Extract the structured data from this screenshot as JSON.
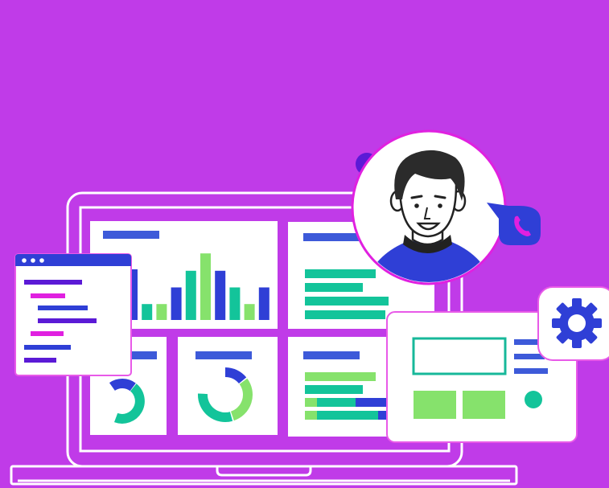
{
  "illustration": {
    "background": "#c03be8",
    "colors": {
      "outline": "#ffffff",
      "panel": "#ffffff",
      "blue": "#3d5ad9",
      "royal": "#2f3fd6",
      "purple": "#5b1ad6",
      "teal": "#13c49a",
      "green": "#86e26c",
      "magenta": "#e020e0",
      "teal_frame": "#17b89a"
    },
    "bar_chart": {
      "series": [
        {
          "name": "",
          "values": [
            70,
            22,
            22,
            45,
            68,
            92,
            68,
            45,
            22,
            45
          ]
        }
      ],
      "bar_colors": [
        "royal",
        "teal",
        "green",
        "royal",
        "teal",
        "green",
        "royal",
        "teal",
        "green",
        "royal"
      ]
    },
    "horizontal_bars": {
      "values": [
        88,
        72,
        104,
        100
      ]
    },
    "donut_left": {
      "segments": [
        {
          "value": 20,
          "color": "royal"
        },
        {
          "value": 45,
          "color": "teal"
        }
      ]
    },
    "donut_right": {
      "segments": [
        {
          "value": 14,
          "color": "royal"
        },
        {
          "value": 30,
          "color": "green"
        },
        {
          "value": 30,
          "color": "teal"
        }
      ]
    },
    "stacked_bars": {
      "rows": [
        [
          {
            "v": 88,
            "c": "green"
          }
        ],
        [
          {
            "v": 72,
            "c": "teal"
          }
        ],
        [
          {
            "v": 15,
            "c": "green"
          },
          {
            "v": 48,
            "c": "teal"
          },
          {
            "v": 40,
            "c": "royal"
          }
        ],
        [
          {
            "v": 15,
            "c": "green"
          },
          {
            "v": 76,
            "c": "teal"
          },
          {
            "v": 20,
            "c": "royal"
          }
        ]
      ]
    },
    "icons": {
      "avatar": "support-agent-avatar-icon",
      "phone": "phone-icon",
      "gear": "gear-icon",
      "window_dots": "window-dots-icon"
    }
  }
}
